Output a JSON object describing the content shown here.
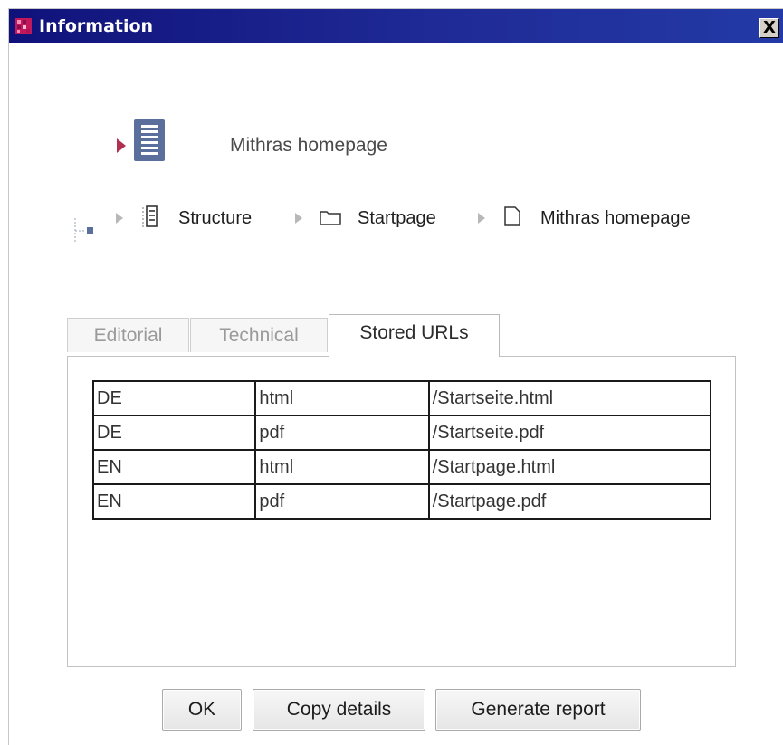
{
  "window": {
    "title": "Information",
    "close_label": "X"
  },
  "object": {
    "name": "Mithras homepage",
    "type_icon": "page-document-icon"
  },
  "path": [
    {
      "label": "Structure",
      "icon": "structure-icon"
    },
    {
      "label": "Startpage",
      "icon": "folder-icon"
    },
    {
      "label": "Mithras homepage",
      "icon": "page-icon"
    }
  ],
  "tabs": [
    {
      "label": "Editorial",
      "active": false
    },
    {
      "label": "Technical",
      "active": false
    },
    {
      "label": "Stored URLs",
      "active": true
    }
  ],
  "stored_urls": {
    "rows": [
      [
        "DE",
        "html",
        "/Startseite.html"
      ],
      [
        "DE",
        "pdf",
        "/Startseite.pdf"
      ],
      [
        "EN",
        "html",
        "/Startpage.html"
      ],
      [
        "EN",
        "pdf",
        "/Startpage.pdf"
      ]
    ]
  },
  "buttons": {
    "ok": "OK",
    "copy": "Copy details",
    "report": "Generate report"
  },
  "colors": {
    "titlebar": "#1a2290",
    "doc_icon": "#5a6f9c",
    "arrow": "#b03050"
  }
}
